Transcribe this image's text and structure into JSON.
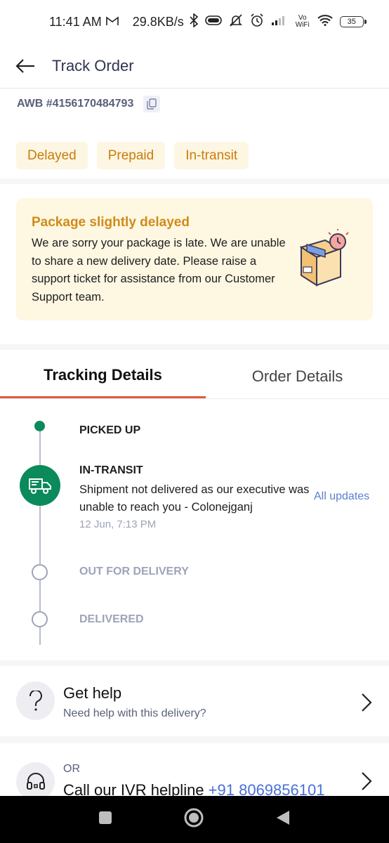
{
  "status_bar": {
    "time": "11:41 AM",
    "network_speed": "29.8KB/s",
    "battery": "35",
    "icons": [
      "gmail-icon",
      "bluetooth-icon",
      "toggle-icon",
      "mute-icon",
      "alarm-icon",
      "signal-icon",
      "vowifi-icon",
      "wifi-icon",
      "battery-icon"
    ],
    "vowifi_label": "Vo WiFi"
  },
  "header": {
    "title": "Track Order"
  },
  "awb": {
    "label": "AWB #4156170484793"
  },
  "badges": [
    "Delayed",
    "Prepaid",
    "In-transit"
  ],
  "delay_notice": {
    "title": "Package slightly delayed",
    "message": "We are sorry your package is late. We are unable to share a new delivery date. Please raise a support ticket for assistance from our Customer Support team."
  },
  "tabs": [
    {
      "label": "Tracking Details",
      "active": true
    },
    {
      "label": "Order Details",
      "active": false
    }
  ],
  "timeline": {
    "steps": [
      {
        "label": "PICKED UP",
        "status": "done"
      },
      {
        "label": "IN-TRANSIT",
        "status": "current",
        "description": "Shipment not delivered as our executive was unable to reach you - Colonejganj",
        "time": "12 Jun, 7:13 PM"
      },
      {
        "label": "OUT FOR DELIVERY",
        "status": "pending"
      },
      {
        "label": "DELIVERED",
        "status": "pending"
      }
    ],
    "all_updates_label": "All updates"
  },
  "help": {
    "title": "Get help",
    "subtitle": "Need help with this delivery?",
    "icon": "question-icon"
  },
  "ivr": {
    "prefix": "OR",
    "title": "Call our IVR helpline",
    "number": "+91 8069856101",
    "icon": "headset-icon"
  },
  "colors": {
    "accent_orange": "#e05a3a",
    "badge_text": "#cb7c08",
    "badge_bg": "#fdf6e3",
    "delay_title": "#d08b1a",
    "timeline_green": "#0b8a5c",
    "link_blue": "#5a7fd0"
  }
}
